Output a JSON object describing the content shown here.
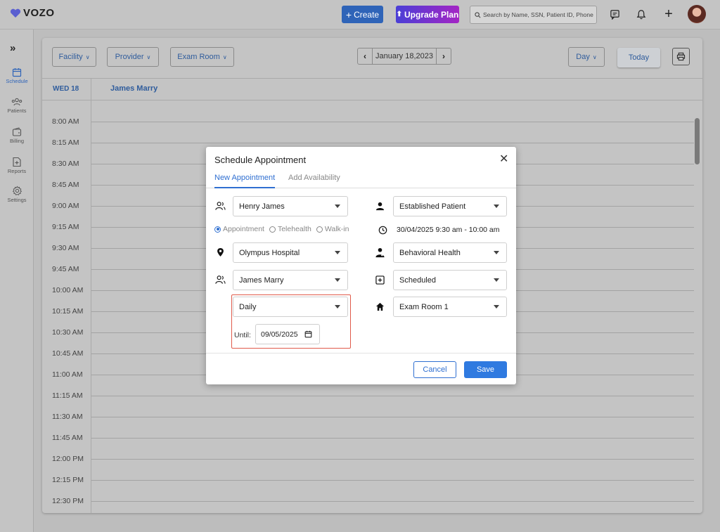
{
  "app": {
    "logo_text": "VOZO",
    "brand_color": "#2f64b8"
  },
  "header": {
    "create_label": "Create",
    "upgrade_label": "Upgrade Plan",
    "search_placeholder": "Search by Name, SSN, Patient ID, Phone"
  },
  "sidebar": {
    "items": [
      {
        "label": "Schedule",
        "icon": "calendar-icon"
      },
      {
        "label": "Patients",
        "icon": "users-icon"
      },
      {
        "label": "Billing",
        "icon": "wallet-icon"
      },
      {
        "label": "Reports",
        "icon": "report-icon"
      },
      {
        "label": "Settings",
        "icon": "gear-icon"
      }
    ]
  },
  "toolbar": {
    "facility_label": "Facility",
    "provider_label": "Provider",
    "exam_room_label": "Exam Room",
    "current_date": "January 18,2023",
    "view_label": "Day",
    "today_label": "Today"
  },
  "calendar": {
    "day_label": "WED 18",
    "provider_name": "James Marry",
    "times": [
      "8:00 AM",
      "8:15 AM",
      "8:30 AM",
      "8:45 AM",
      "9:00 AM",
      "9:15 AM",
      "9:30 AM",
      "9:45 AM",
      "10:00 AM",
      "10:15 AM",
      "10:30 AM",
      "10:45 AM",
      "11:00 AM",
      "11:15 AM",
      "11:30 AM",
      "11:45 AM",
      "12:00 PM",
      "12:15 PM",
      "12:30 PM"
    ]
  },
  "modal": {
    "title": "Schedule Appointment",
    "tabs": {
      "new": "New Appointment",
      "availability": "Add Availability"
    },
    "patient": "Henry James",
    "patient_type": "Established Patient",
    "appointment_types": {
      "appointment": "Appointment",
      "telehealth": "Telehealth",
      "walkin": "Walk-in"
    },
    "datetime": "30/04/2025  9:30 am - 10:00 am",
    "facility": "Olympus Hospital",
    "specialty": "Behavioral Health",
    "provider": "James Marry",
    "status": "Scheduled",
    "recurrence": "Daily",
    "room": "Exam Room 1",
    "until_label": "Until:",
    "until_date": "09/05/2025",
    "cancel_label": "Cancel",
    "save_label": "Save",
    "highlight_color": "#e05a4a"
  }
}
